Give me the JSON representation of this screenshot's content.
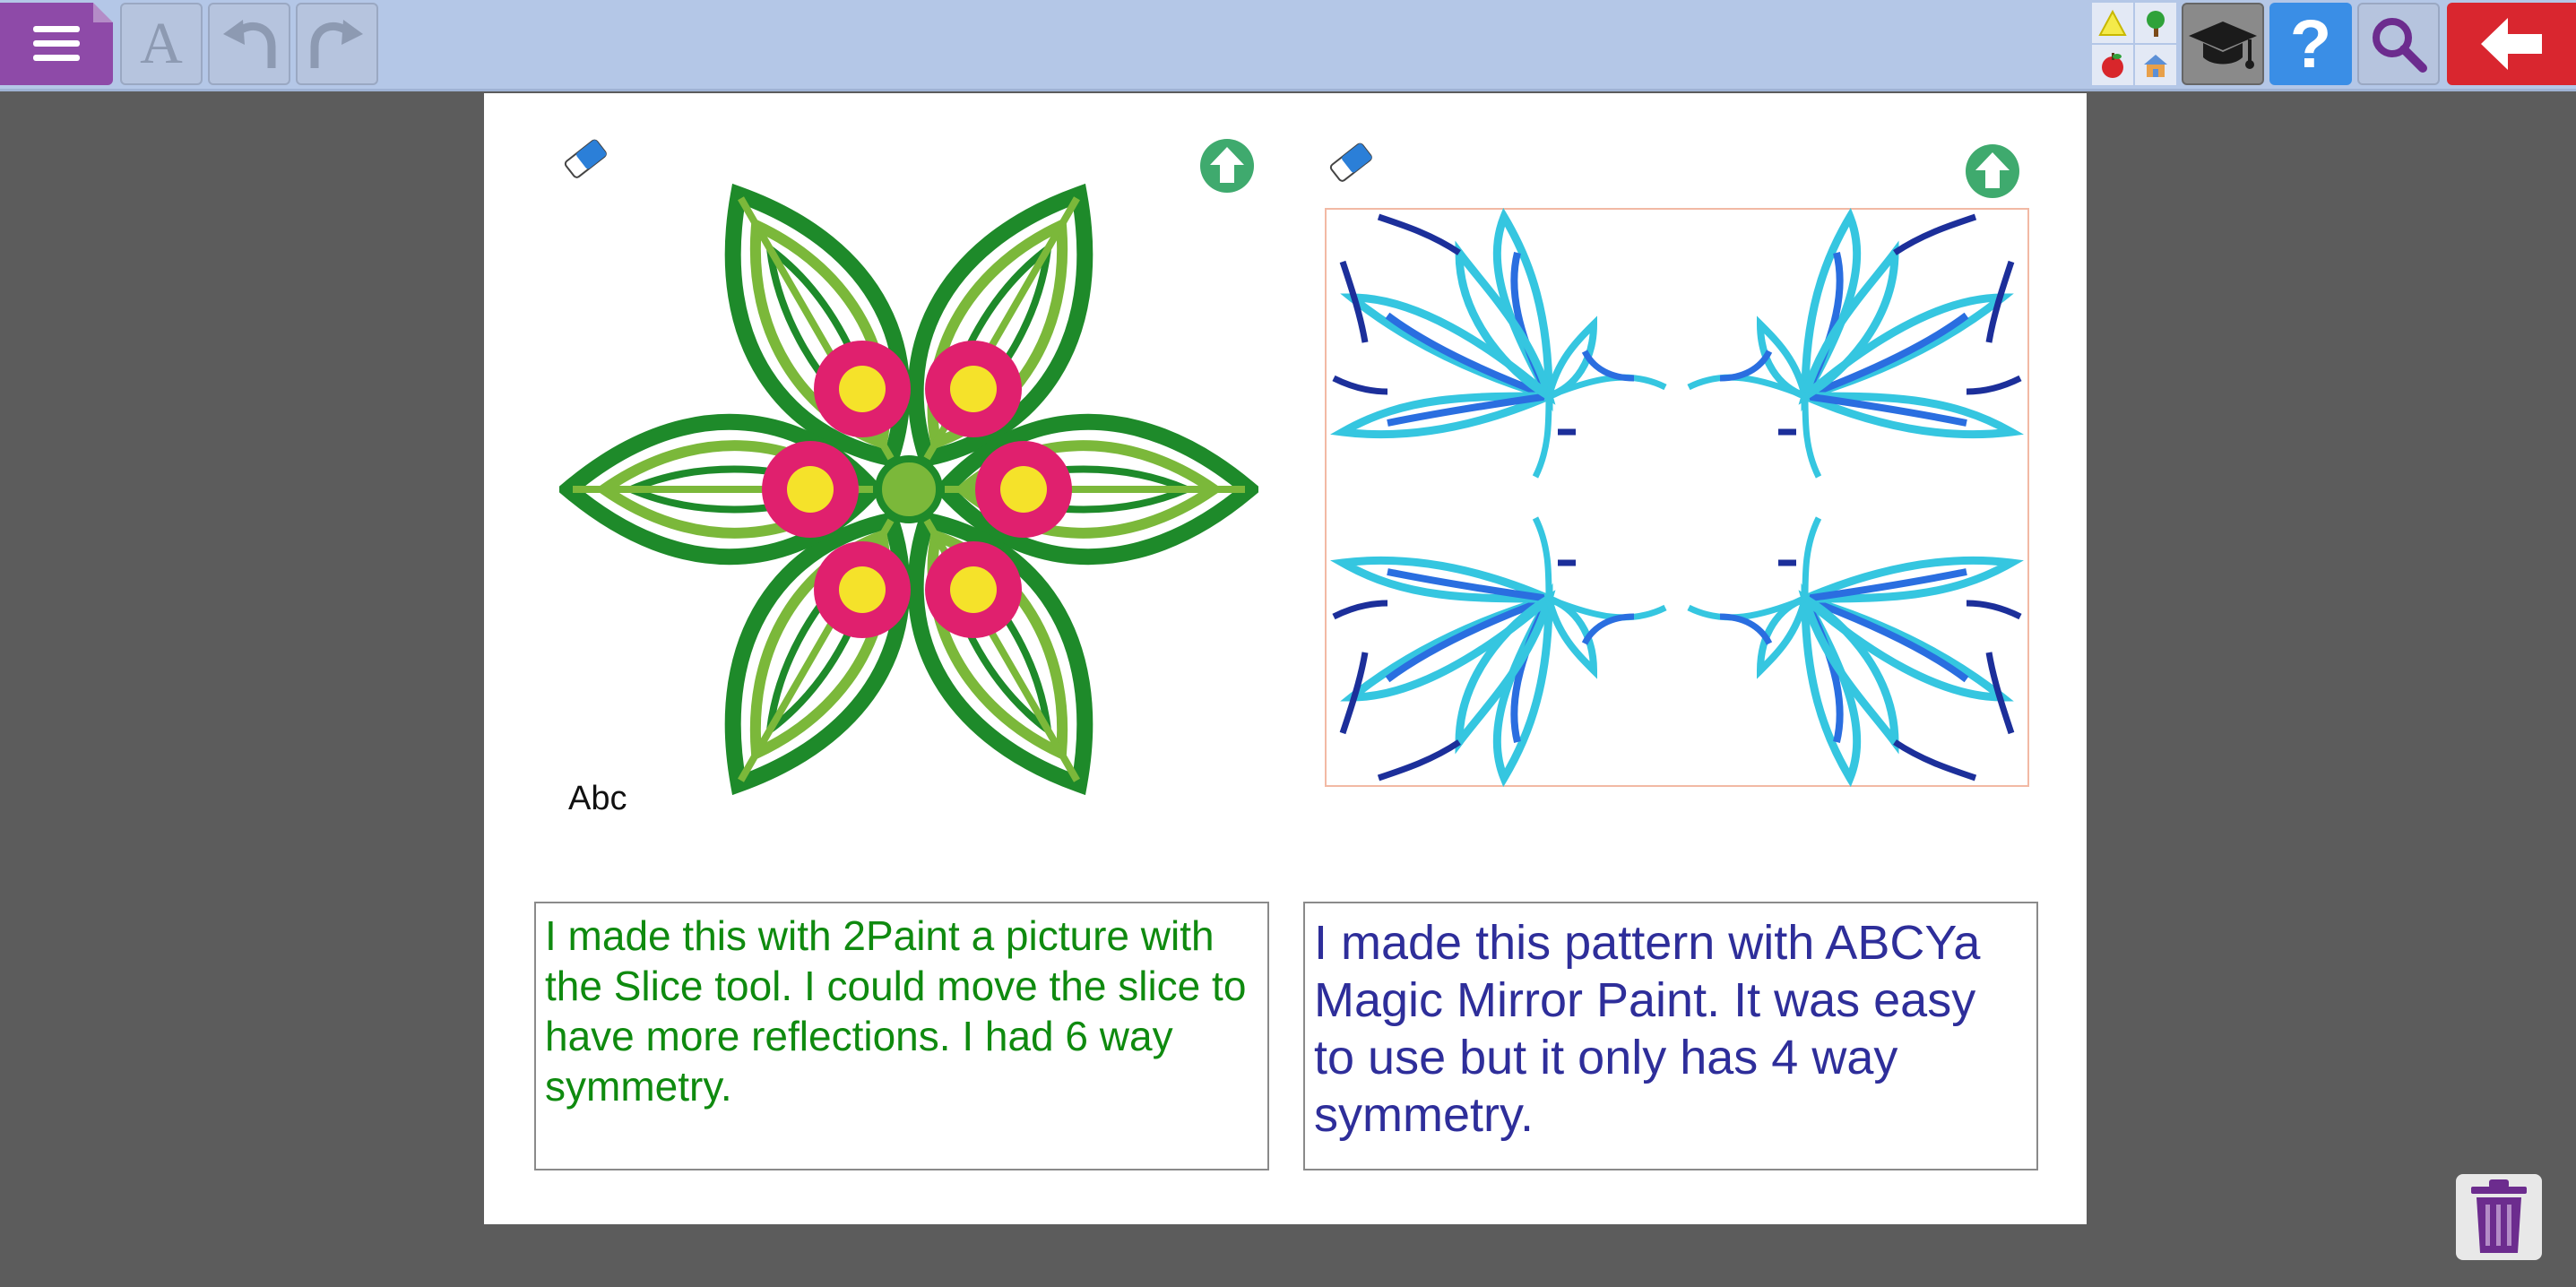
{
  "toolbar": {
    "font_label": "A",
    "help_label": "?",
    "icons": [
      "menu-icon",
      "font-icon",
      "undo-icon",
      "redo-icon",
      "triangle-icon",
      "tree-icon",
      "apple-icon",
      "house-icon",
      "graduation-cap-icon",
      "help-icon",
      "search-icon",
      "back-arrow-icon"
    ]
  },
  "left_panel": {
    "caption": "Abc",
    "text": "I made this with 2Paint a picture with the Slice tool. I could move the slice to have more reflections. I had 6 way symmetry.",
    "text_color": "#0f8a0f"
  },
  "right_panel": {
    "text": "I made this pattern with ABCYa Magic Mirror Paint. It was easy to use but it only has 4 way symmetry.",
    "text_color": "#2e2e9a"
  },
  "colors": {
    "toolbar_bg": "#b4c7e7",
    "menu": "#8e4aa8",
    "help": "#3a8ee6",
    "back": "#d9262f",
    "upload": "#3faa6e",
    "leaf_dark": "#1e8a2a",
    "leaf_light": "#7bb83a",
    "flower": "#e0206e",
    "flower_center": "#f5e22a",
    "cyan": "#35c6e0",
    "blue": "#2a6ee0",
    "navy": "#1c2f9a"
  }
}
